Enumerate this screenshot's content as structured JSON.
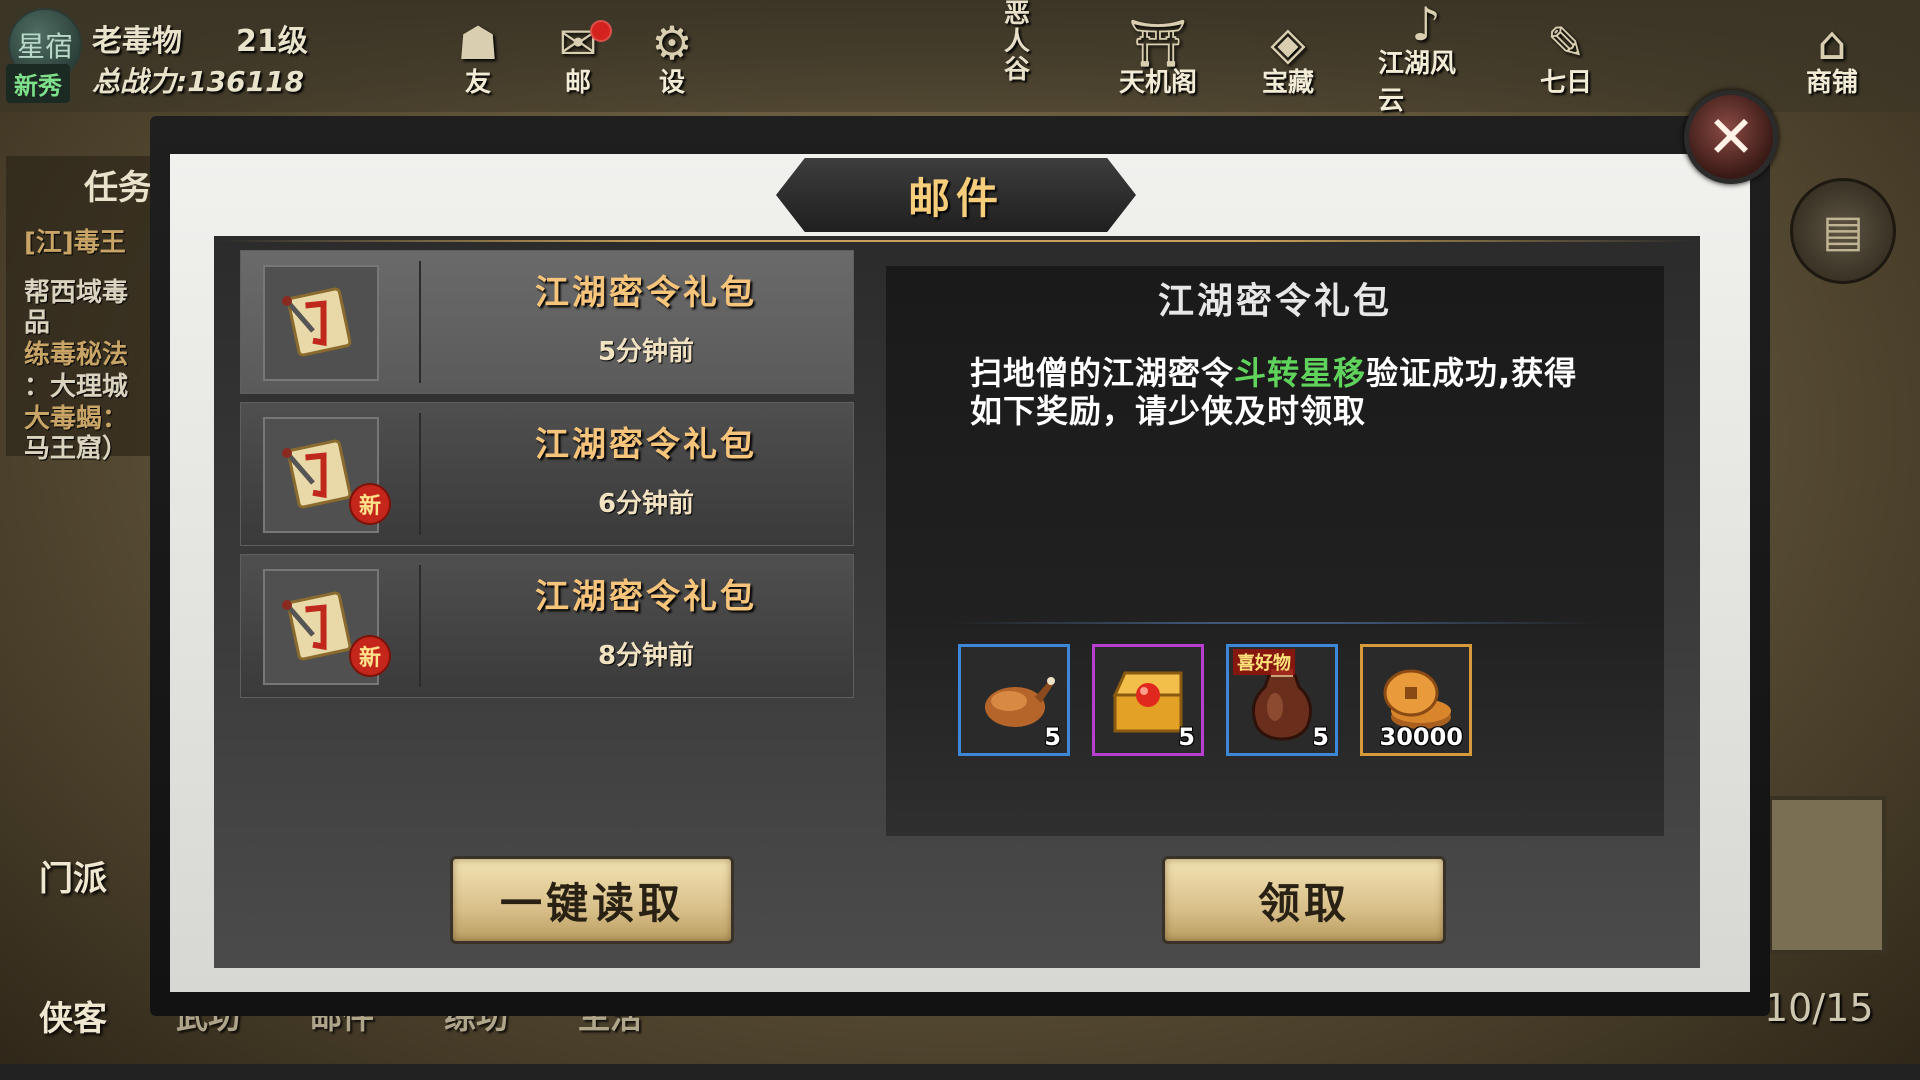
{
  "player": {
    "avatar_text": "星宿",
    "rank_badge": "新秀",
    "name": "老毒物",
    "level": "21级",
    "combat_power": "总战力:136118"
  },
  "top_menu": [
    {
      "label": "友",
      "icon": "friend-icon"
    },
    {
      "label": "邮",
      "icon": "mail-icon",
      "has_alert": true
    },
    {
      "label": "设",
      "icon": "gear-icon"
    },
    {
      "label": "天机阁",
      "icon": "pavilion-icon"
    },
    {
      "label": "宝藏",
      "icon": "treasure-icon"
    },
    {
      "label": "江湖风云",
      "icon": "horn-icon"
    },
    {
      "label": "七日",
      "icon": "scroll-icon"
    },
    {
      "label": "商铺",
      "icon": "shop-icon"
    }
  ],
  "map_label": "恶人谷",
  "task_panel": {
    "title": "任务",
    "lines": [
      {
        "text": "[江]毒王",
        "color": "#c8a566"
      },
      {
        "text": "帮西域毒",
        "color": "#d9d3bf"
      },
      {
        "text": "品",
        "color": "#d9d3bf"
      },
      {
        "text": "练毒秘法",
        "color": "#c8a566"
      },
      {
        "text": "：大理城",
        "color": "#d9d3bf"
      },
      {
        "text": "大毒蝎：",
        "color": "#c8a566"
      },
      {
        "text": "马王窟）",
        "color": "#d9d3bf"
      }
    ]
  },
  "left_menu": [
    {
      "label": "门派"
    },
    {
      "label": "侠客"
    }
  ],
  "bottom_tabs": [
    "武功",
    "邮件",
    "练功",
    "生活"
  ],
  "progress_text": "10/15",
  "dialog": {
    "title": "邮件",
    "mails": [
      {
        "title": "江湖密令礼包",
        "time": "5分钟前",
        "is_new": false,
        "selected": true
      },
      {
        "title": "江湖密令礼包",
        "time": "6分钟前",
        "is_new": true,
        "selected": false
      },
      {
        "title": "江湖密令礼包",
        "time": "8分钟前",
        "is_new": true,
        "selected": false
      }
    ],
    "new_badge": "新",
    "detail": {
      "title": "江湖密令礼包",
      "message_part1": "扫地僧的江湖密令",
      "message_highlight": "斗转星移",
      "message_part2": "验证成功,获得如下奖励，请少侠及时领取",
      "highlight_color": "#5fd35b"
    },
    "rewards": [
      {
        "name": "roast-chicken",
        "quantity": "5",
        "rarity": "blue"
      },
      {
        "name": "treasure-chest",
        "quantity": "5",
        "rarity": "purple"
      },
      {
        "name": "wine-jar",
        "quantity": "5",
        "rarity": "blue",
        "tag": "喜好物"
      },
      {
        "name": "copper-coins",
        "quantity": "30000",
        "rarity": "gold"
      }
    ],
    "read_all_button": "一键读取",
    "claim_button": "领取"
  }
}
